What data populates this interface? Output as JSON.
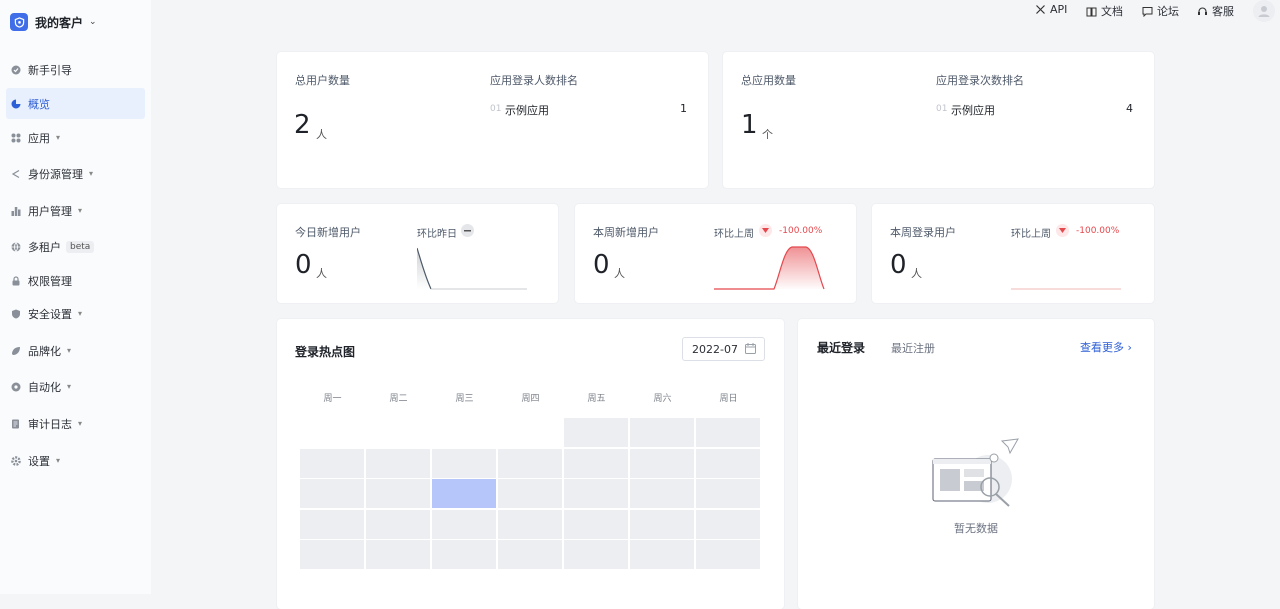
{
  "brand": {
    "title": "我的客户"
  },
  "nav": [
    {
      "label": "新手引导",
      "icon": "guide-icon"
    },
    {
      "label": "概览",
      "icon": "overview-icon",
      "active": true
    },
    {
      "label": "应用",
      "icon": "apps-icon",
      "caret": true
    },
    {
      "label": "身份源管理",
      "icon": "share-icon",
      "caret": true
    },
    {
      "label": "用户管理",
      "icon": "users-icon",
      "caret": true
    },
    {
      "label": "多租户",
      "icon": "globe-icon",
      "badge": "beta"
    },
    {
      "label": "权限管理",
      "icon": "lock-icon"
    },
    {
      "label": "安全设置",
      "icon": "shield-icon",
      "caret": true
    },
    {
      "label": "品牌化",
      "icon": "brand-icon",
      "caret": true
    },
    {
      "label": "自动化",
      "icon": "automation-icon",
      "caret": true
    },
    {
      "label": "审计日志",
      "icon": "log-icon",
      "caret": true
    },
    {
      "label": "设置",
      "icon": "gear-icon",
      "caret": true
    }
  ],
  "topbar": {
    "api": "API",
    "docs": "文档",
    "forum": "论坛",
    "support": "客服"
  },
  "stats_users": {
    "total_label": "总用户数量",
    "total_value": "2",
    "total_unit": "人",
    "rank_label": "应用登录人数排名",
    "rank_idx": "01",
    "rank_name": "示例应用",
    "rank_value": "1"
  },
  "stats_apps": {
    "total_label": "总应用数量",
    "total_value": "1",
    "total_unit": "个",
    "rank_label": "应用登录次数排名",
    "rank_idx": "01",
    "rank_name": "示例应用",
    "rank_value": "4"
  },
  "today_new": {
    "label": "今日新增用户",
    "value": "0",
    "unit": "人",
    "compare_label": "环比昨日"
  },
  "week_new": {
    "label": "本周新增用户",
    "value": "0",
    "unit": "人",
    "compare_label": "环比上周",
    "change": "-100.00%"
  },
  "week_login": {
    "label": "本周登录用户",
    "value": "0",
    "unit": "人",
    "compare_label": "环比上周",
    "change": "-100.00%"
  },
  "heatmap": {
    "title": "登录热点图",
    "month": "2022-07",
    "weekdays": [
      "周一",
      "周二",
      "周三",
      "周四",
      "周五",
      "周六",
      "周日"
    ],
    "highlight_day": 13
  },
  "recent": {
    "title": "最近登录",
    "tab2": "最近注册",
    "more": "查看更多",
    "empty_text": "暂无数据"
  },
  "colors": {
    "accent": "#2d5fd6",
    "negative": "#e5484d",
    "heat_high": "#b6c6fa",
    "heat_cell": "#eceef2"
  }
}
